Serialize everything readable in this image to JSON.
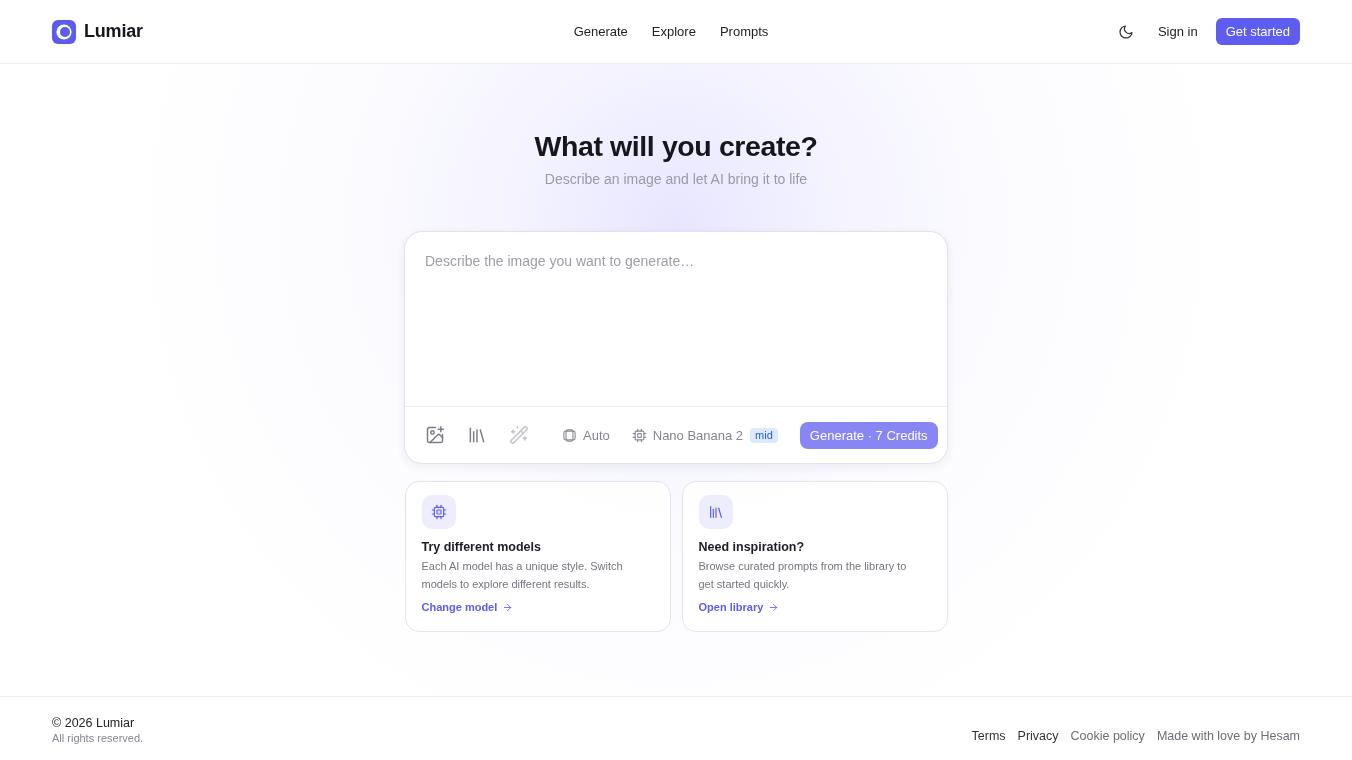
{
  "header": {
    "brand": "Lumiar",
    "nav": [
      "Generate",
      "Explore",
      "Prompts"
    ],
    "sign_in": "Sign in",
    "cta": "Get started"
  },
  "hero": {
    "title": "What will you create?",
    "subtitle": "Describe an image and let AI bring it to life"
  },
  "prompt": {
    "placeholder": "Describe the image you want to generate…",
    "tools": [
      {
        "disabled": false
      },
      {
        "disabled": false
      },
      {
        "disabled": true
      }
    ],
    "chips": [
      {
        "label": "Auto"
      },
      {
        "label": "Nano Banana 2",
        "badge": "mid"
      }
    ],
    "generate": {
      "label": "Generate · 7 Credits",
      "disabled": true
    }
  },
  "cards": [
    {
      "title": "Try different models",
      "description": "Each AI model has a unique style. Switch models to explore different results.",
      "link": "Change model"
    },
    {
      "title": "Need inspiration?",
      "description": "Browse curated prompts from the library to get started quickly.",
      "link": "Open library"
    }
  ],
  "footer": {
    "copyright": "© 2026 Lumiar",
    "rights": "All rights reserved.",
    "links": [
      "Terms",
      "Privacy",
      "Cookie policy",
      "Made with love by Hesam"
    ]
  }
}
